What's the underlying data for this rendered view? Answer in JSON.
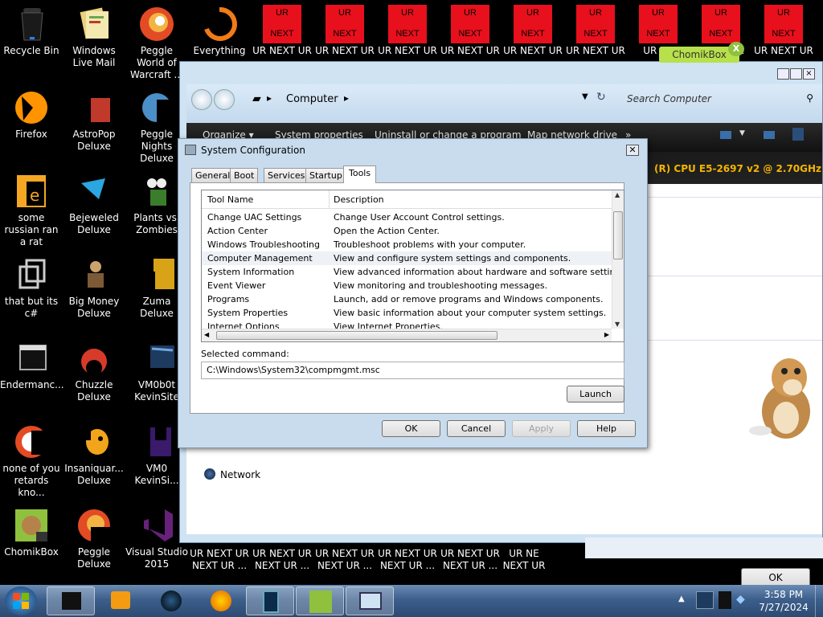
{
  "desktop": {
    "icons": [
      {
        "label": "Recycle Bin"
      },
      {
        "label": "Windows Live Mail"
      },
      {
        "label": "Peggle World of Warcraft ..."
      },
      {
        "label": "Everything"
      },
      {
        "label": "UR NEXT UR"
      },
      {
        "label": "UR NEXT UR"
      },
      {
        "label": "UR NEXT UR"
      },
      {
        "label": "UR NEXT UR"
      },
      {
        "label": "UR NEXT UR"
      },
      {
        "label": "UR NEXT UR"
      },
      {
        "label": "UR NE"
      },
      {
        "label": "UR"
      },
      {
        "label": "UR NEXT UR"
      },
      {
        "label": "Firefox"
      },
      {
        "label": "AstroPop Deluxe"
      },
      {
        "label": "Peggle Nights Deluxe"
      },
      {
        "label": "some russian ran a rat"
      },
      {
        "label": "Bejeweled Deluxe"
      },
      {
        "label": "Plants vs. Zombies"
      },
      {
        "label": "that but its c#"
      },
      {
        "label": "Big Money Deluxe"
      },
      {
        "label": "Zuma Deluxe"
      },
      {
        "label": "Endermanc..."
      },
      {
        "label": "Chuzzle Deluxe"
      },
      {
        "label": "VM0b0t KevinSite"
      },
      {
        "label": "none of you retards kno..."
      },
      {
        "label": "Insaniquar... Deluxe"
      },
      {
        "label": "VM0 KevinSi..."
      },
      {
        "label": "ChomikBox"
      },
      {
        "label": "Peggle Deluxe"
      },
      {
        "label": "Visual Studio 2015"
      },
      {
        "label": "UR NEXT UR NEXT UR ..."
      },
      {
        "label": "UR NEXT UR NEXT UR ..."
      },
      {
        "label": "UR NEXT UR NEXT UR ..."
      },
      {
        "label": "UR NEXT UR NEXT UR ..."
      },
      {
        "label": "UR NEXT UR NEXT UR ..."
      },
      {
        "label": "UR NE NEXT UR"
      }
    ],
    "ur_tile": {
      "top": "UR",
      "bottom": "NEXT"
    }
  },
  "chomik_popup": {
    "label": "ChomikBox",
    "close": "X"
  },
  "explorer": {
    "location": "Computer",
    "search_placeholder": "Search Computer",
    "toolbar": {
      "organize": "Organize ▾",
      "system_properties": "System properties",
      "uninstall": "Uninstall or change a program",
      "map_drive": "Map network drive",
      "more": "»"
    },
    "cpu_text": "(R) CPU E5-2697 v2 @ 2.70GHz",
    "network_label": "Network",
    "ok_label": "OK"
  },
  "dialog": {
    "title": "System Configuration",
    "tabs": [
      "General",
      "Boot",
      "Services",
      "Startup",
      "Tools"
    ],
    "active_tab": "Tools",
    "columns": {
      "name": "Tool Name",
      "description": "Description"
    },
    "rows": [
      {
        "name": "Change UAC Settings",
        "description": "Change User Account Control settings."
      },
      {
        "name": "Action Center",
        "description": "Open the Action Center."
      },
      {
        "name": "Windows Troubleshooting",
        "description": "Troubleshoot problems with your computer."
      },
      {
        "name": "Computer Management",
        "description": "View and configure system settings and components."
      },
      {
        "name": "System Information",
        "description": "View advanced information about hardware and software settings."
      },
      {
        "name": "Event Viewer",
        "description": "View monitoring and troubleshooting messages."
      },
      {
        "name": "Programs",
        "description": "Launch, add or remove programs and Windows components."
      },
      {
        "name": "System Properties",
        "description": "View basic information about your computer system settings."
      },
      {
        "name": "Internet Options",
        "description": "View Internet Properties."
      }
    ],
    "selected_row": "Computer Management",
    "selected_command_label": "Selected command:",
    "selected_command": "C:\\Windows\\System32\\compmgmt.msc",
    "launch": "Launch",
    "buttons": {
      "ok": "OK",
      "cancel": "Cancel",
      "apply": "Apply",
      "help": "Help"
    }
  },
  "taskbar": {
    "time": "3:58 PM",
    "date": "7/27/2024"
  }
}
